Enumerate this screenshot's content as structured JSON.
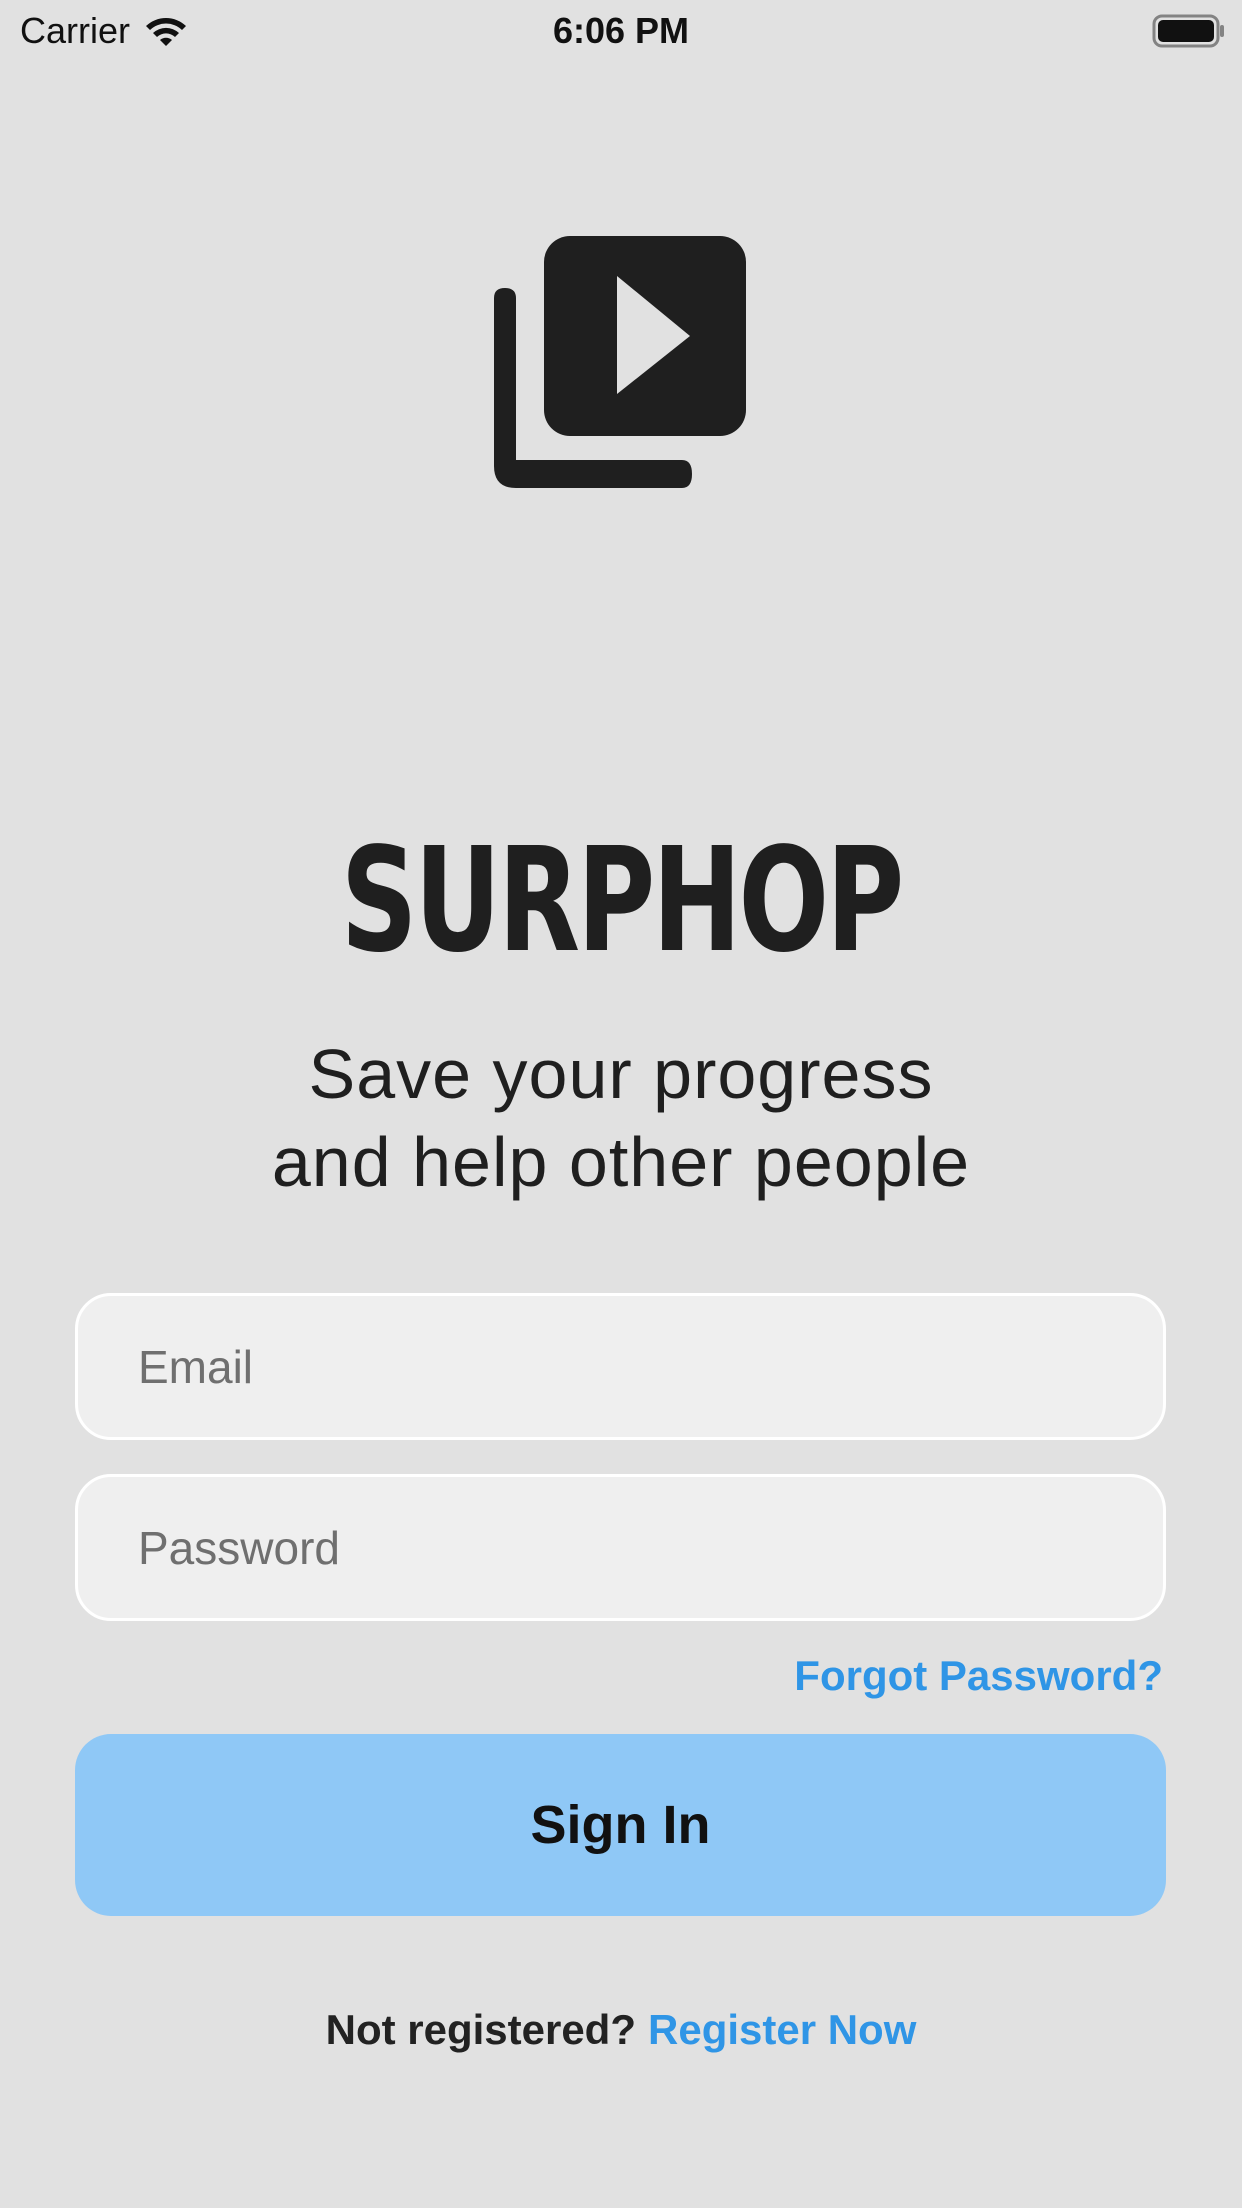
{
  "status_bar": {
    "carrier": "Carrier",
    "time": "6:06 PM",
    "wifi_icon": "wifi-icon",
    "battery_icon": "battery-full-icon"
  },
  "logo": {
    "icon": "video-library-icon",
    "color": "#1f1f1f"
  },
  "brand": {
    "name": "SURPHOP"
  },
  "tagline": {
    "line1": "Save your progress",
    "line2": "and help other people"
  },
  "form": {
    "email_placeholder": "Email",
    "password_placeholder": "Password",
    "forgot_label": "Forgot Password?",
    "signin_label": "Sign In"
  },
  "register": {
    "prompt": "Not registered?",
    "link_label": "Register Now"
  },
  "colors": {
    "background": "#e1e1e1",
    "accent": "#2f95e6",
    "button": "#8fc8f6",
    "field": "#efefef",
    "text": "#1f1f1f"
  }
}
